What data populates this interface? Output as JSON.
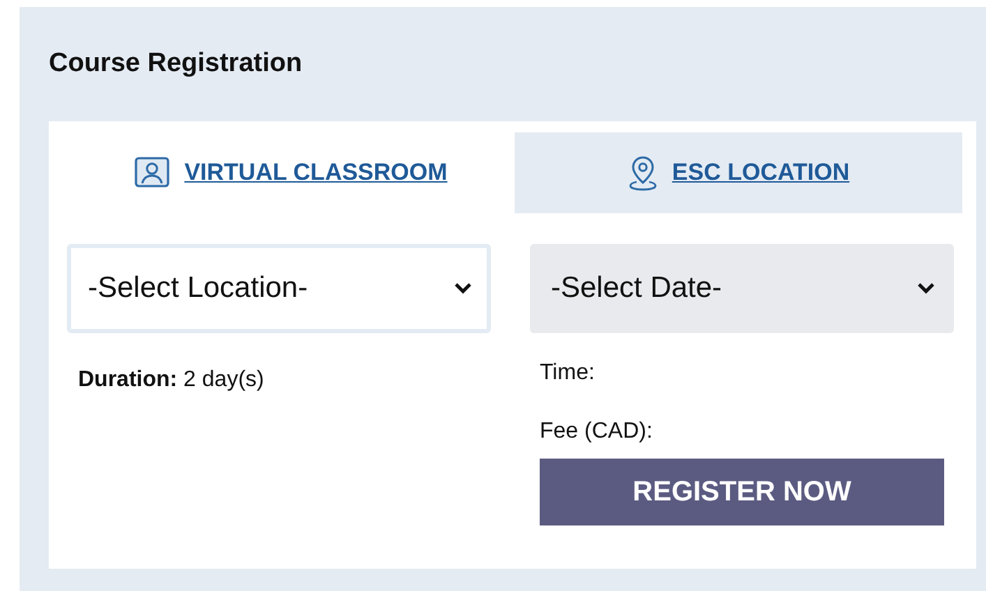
{
  "title": "Course Registration",
  "tabs": [
    {
      "label": "VIRTUAL CLASSROOM",
      "kind": "virtual",
      "selected": true
    },
    {
      "label": "ESC LOCATION",
      "kind": "location",
      "selected": false
    }
  ],
  "selects": [
    {
      "value": "-Select Location-",
      "disabled": false
    },
    {
      "value": "-Select Date-",
      "disabled": true
    }
  ],
  "duration": "**Duration:** 2 day(s)",
  "time_label": "Time:",
  "fee_label": "Fee (CAD):",
  "register_button": "REGISTER NOW"
}
